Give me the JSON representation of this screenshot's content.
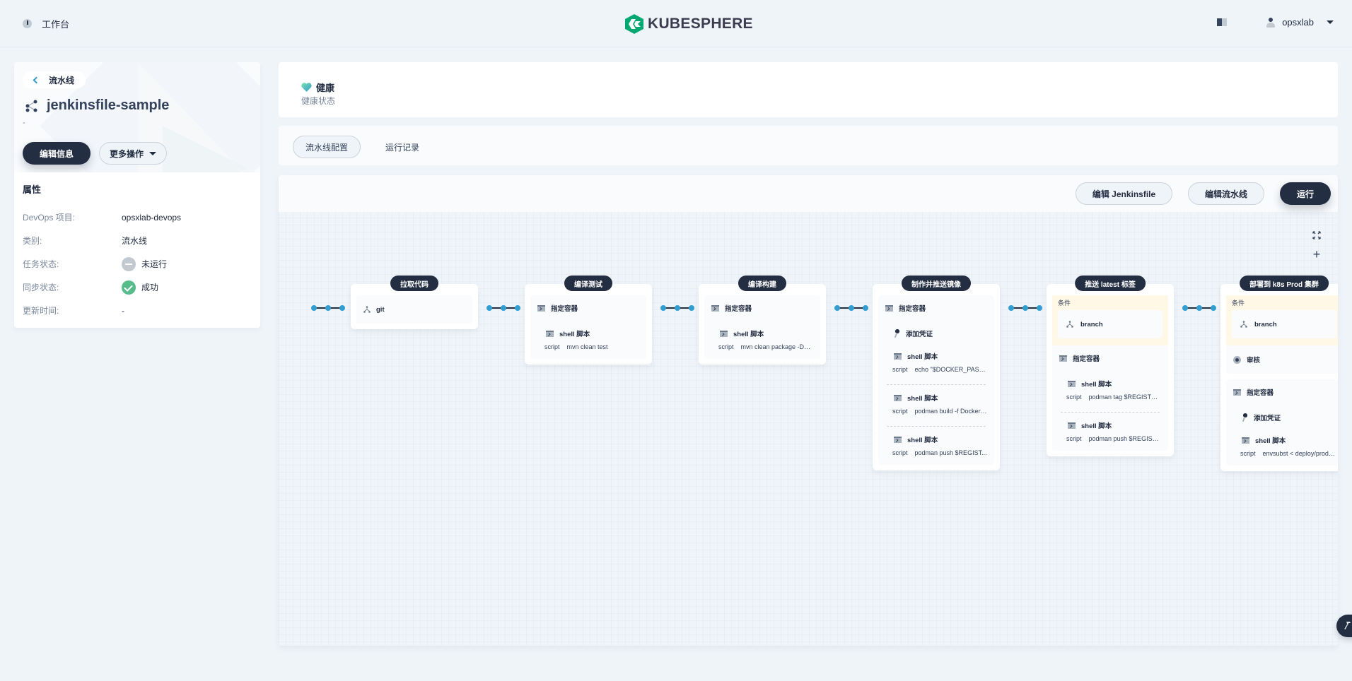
{
  "topnav": {
    "workbench_label": "工作台",
    "logo_text": "KUBESPHERE",
    "brand_color": "#00a971",
    "user_name": "opsxlab"
  },
  "left_panel": {
    "back_label": "流水线",
    "title": "jenkinsfile-sample",
    "description": "-",
    "edit_info_label": "编辑信息",
    "more_actions_label": "更多操作",
    "props_title": "属性",
    "props": [
      {
        "key": "DevOps 项目:",
        "value": "opsxlab-devops"
      },
      {
        "key": "类别:",
        "value": "流水线"
      },
      {
        "key": "任务状态:",
        "value": "未运行",
        "status": "none"
      },
      {
        "key": "同步状态:",
        "value": "成功",
        "status": "success"
      },
      {
        "key": "更新时间:",
        "value": "-"
      }
    ]
  },
  "health": {
    "label": "健康",
    "sub_label": "健康状态"
  },
  "tabs": [
    {
      "label": "流水线配置",
      "active": true
    },
    {
      "label": "运行记录",
      "active": false
    }
  ],
  "toolbar": {
    "edit_jenkinsfile_label": "编辑 Jenkinsfile",
    "edit_pipeline_label": "编辑流水线",
    "run_label": "运行"
  },
  "pipeline": {
    "stages": [
      {
        "title": "拉取代码",
        "steps": [
          {
            "icon": "branch",
            "label": "git"
          }
        ]
      },
      {
        "title": "编译测试",
        "steps": [
          {
            "icon": "terminal",
            "label": "指定容器"
          },
          {
            "icon": "terminal",
            "label": "shell 脚本",
            "sub": true,
            "script_key": "script",
            "script": "mvn clean test"
          }
        ]
      },
      {
        "title": "编译构建",
        "steps": [
          {
            "icon": "terminal",
            "label": "指定容器"
          },
          {
            "icon": "terminal",
            "label": "shell 脚本",
            "sub": true,
            "script_key": "script",
            "script": "mvn clean package -DskipT..."
          }
        ]
      },
      {
        "title": "制作并推送镜像",
        "steps": [
          {
            "icon": "terminal",
            "label": "指定容器"
          },
          {
            "icon": "key",
            "label": "添加凭证",
            "sub": true
          },
          {
            "icon": "terminal",
            "label": "shell 脚本",
            "sub": true,
            "script_key": "script",
            "script": "echo \"$DOCKER_PASS..."
          },
          {
            "icon": "terminal",
            "label": "shell 脚本",
            "sub": true,
            "script_key": "script",
            "script": "podman build -f Dockerfi..."
          },
          {
            "icon": "terminal",
            "label": "shell 脚本",
            "sub": true,
            "script_key": "script",
            "script": "podman push $REGIST..."
          }
        ]
      },
      {
        "title": "推送 latest 标签",
        "condition_label": "条件",
        "condition": "branch",
        "steps": [
          {
            "icon": "terminal",
            "label": "指定容器"
          },
          {
            "icon": "terminal",
            "label": "shell 脚本",
            "sub": true,
            "script_key": "script",
            "script": "podman tag $REGISTRY/$..."
          },
          {
            "icon": "terminal",
            "label": "shell 脚本",
            "sub": true,
            "script_key": "script",
            "script": "podman push $REGISTRY/..."
          }
        ]
      },
      {
        "title": "部署到 k8s Prod 集群",
        "condition_label": "条件",
        "condition": "branch",
        "audit_label": "审核",
        "steps": [
          {
            "icon": "terminal",
            "label": "指定容器"
          },
          {
            "icon": "key",
            "label": "添加凭证",
            "sub": true
          },
          {
            "icon": "terminal",
            "label": "shell 脚本",
            "sub": true,
            "script_key": "script",
            "script": "envsubst < deploy/prod-..."
          }
        ]
      }
    ]
  }
}
